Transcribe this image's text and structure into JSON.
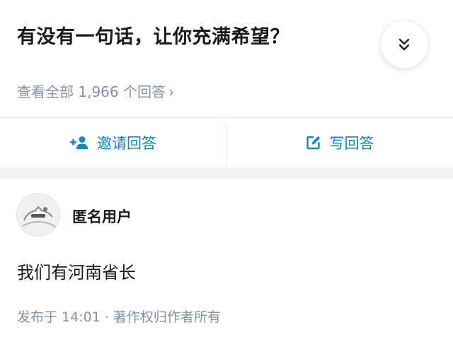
{
  "question": {
    "title": "有没有一句话，让你充满希望？",
    "view_all": "查看全部 1,966 个回答",
    "chevron": "›",
    "collapse_icon": "double-chevron-down-icon"
  },
  "actions": {
    "invite_label": "邀请回答",
    "invite_icon": "add-user-icon",
    "write_label": "写回答",
    "write_icon": "edit-icon",
    "accent_color": "#0f88c9"
  },
  "answer": {
    "author": "匿名用户",
    "content": "我们有河南省长",
    "meta": "发布于 14:01 · 著作权归作者所有"
  }
}
